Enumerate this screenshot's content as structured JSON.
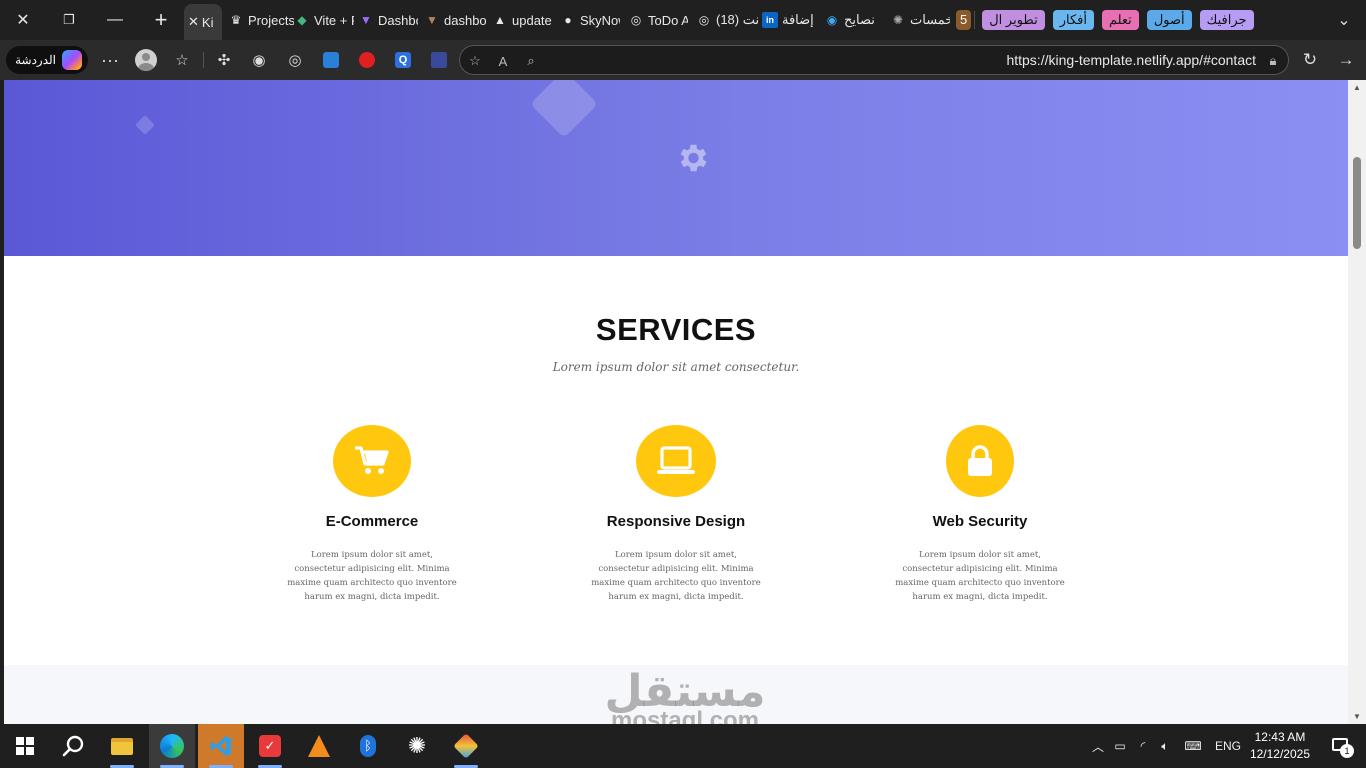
{
  "browser": {
    "tabs": [
      {
        "title": "King",
        "icon": "crown-icon",
        "active": true
      },
      {
        "title": "Projects",
        "icon": "crown-icon"
      },
      {
        "title": "Vite + React",
        "icon": "vue-icon"
      },
      {
        "title": "Dashboard",
        "icon": "vite-icon"
      },
      {
        "title": "dashboard",
        "icon": "vercel-icon"
      },
      {
        "title": "update",
        "icon": "triangle-icon"
      },
      {
        "title": "SkyNow",
        "icon": "github-icon"
      },
      {
        "title": "ToDo App",
        "icon": "globe-icon"
      },
      {
        "title": "(18) نت",
        "icon": "globe-icon"
      }
    ],
    "pinned_tabs": [
      {
        "title": "إضافة",
        "icon": "linkedin-icon"
      },
      {
        "title": "نصايح",
        "icon": "circle-icon"
      },
      {
        "title": "خمسات",
        "icon": "chatgpt-icon"
      }
    ],
    "favorites": [
      {
        "label": "جرافيك",
        "color": "#b79cf3"
      },
      {
        "label": "أصول",
        "color": "#5ba9e8"
      },
      {
        "label": "تعلم",
        "color": "#e86fb3"
      },
      {
        "label": "أفكار",
        "color": "#6ab7f0"
      },
      {
        "label": "تطوير ال",
        "color": "#c08fe0"
      },
      {
        "label": "5",
        "color": "#8a5a2b"
      }
    ],
    "chat_label": "الدردشة",
    "url": "https://king-template.netlify.app/#contact"
  },
  "page": {
    "services_title": "SERVICES",
    "services_subtitle": "Lorem ipsum dolor sit amet consectetur.",
    "services": [
      {
        "title": "E-Commerce",
        "icon": "shopping-cart-icon",
        "text": "Lorem ipsum dolor sit amet, consectetur adipisicing elit. Minima maxime quam architecto quo inventore harum ex magni, dicta impedit."
      },
      {
        "title": "Responsive Design",
        "icon": "laptop-icon",
        "text": "Lorem ipsum dolor sit amet, consectetur adipisicing elit. Minima maxime quam architecto quo inventore harum ex magni, dicta impedit."
      },
      {
        "title": "Web Security",
        "icon": "lock-icon",
        "text": "Lorem ipsum dolor sit amet, consectetur adipisicing elit. Minima maxime quam architecto quo inventore harum ex magni, dicta impedit."
      }
    ],
    "accent_color": "#ffc70d"
  },
  "taskbar": {
    "language": "ENG",
    "time": "12:43 AM",
    "date": "12/12/2025",
    "notifications": "1"
  },
  "watermark": {
    "arabic": "مستقل",
    "latin": "mostaql.com"
  }
}
